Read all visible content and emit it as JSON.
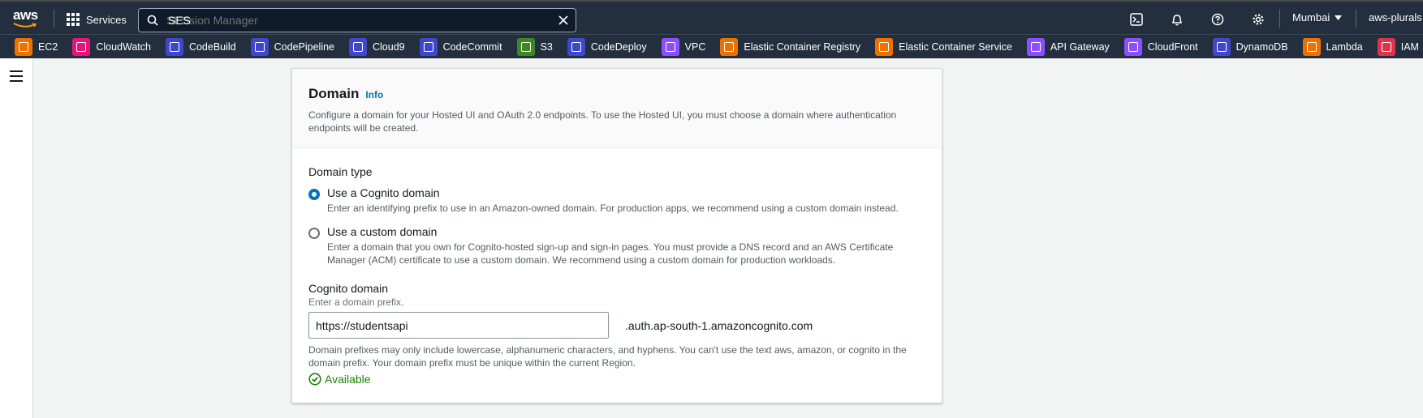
{
  "topnav": {
    "logo_text": "aws",
    "services_label": "Services",
    "search_value": "SES",
    "search_placeholder": "SESsion Manager",
    "region": "Mumbai",
    "account": "aws-plurals",
    "icons": [
      "cloudshell-icon",
      "notifications-bell-icon",
      "help-icon",
      "settings-gear-icon"
    ]
  },
  "favorites": [
    {
      "label": "EC2",
      "color": "#ed7100"
    },
    {
      "label": "CloudWatch",
      "color": "#e7157b"
    },
    {
      "label": "CodeBuild",
      "color": "#3f48cc"
    },
    {
      "label": "CodePipeline",
      "color": "#3f48cc"
    },
    {
      "label": "Cloud9",
      "color": "#3f48cc"
    },
    {
      "label": "CodeCommit",
      "color": "#3f48cc"
    },
    {
      "label": "S3",
      "color": "#3f8624"
    },
    {
      "label": "CodeDeploy",
      "color": "#3f48cc"
    },
    {
      "label": "VPC",
      "color": "#8c4fff"
    },
    {
      "label": "Elastic Container Registry",
      "color": "#ed7100"
    },
    {
      "label": "Elastic Container Service",
      "color": "#ed7100"
    },
    {
      "label": "API Gateway",
      "color": "#8c4fff"
    },
    {
      "label": "CloudFront",
      "color": "#8c4fff"
    },
    {
      "label": "DynamoDB",
      "color": "#3f48cc"
    },
    {
      "label": "Lambda",
      "color": "#ed7100"
    },
    {
      "label": "IAM",
      "color": "#dd344c"
    },
    {
      "label": "",
      "color": "#dd344c"
    }
  ],
  "domain": {
    "title": "Domain",
    "info_link": "Info",
    "description": "Configure a domain for your Hosted UI and OAuth 2.0 endpoints. To use the Hosted UI, you must choose a domain where authentication endpoints will be created.",
    "type_label": "Domain type",
    "options": [
      {
        "label": "Use a Cognito domain",
        "description": "Enter an identifying prefix to use in an Amazon-owned domain. For production apps, we recommend using a custom domain instead.",
        "selected": true
      },
      {
        "label": "Use a custom domain",
        "description": "Enter a domain that you own for Cognito-hosted sign-up and sign-in pages. You must provide a DNS record and an AWS Certificate Manager (ACM) certificate to use a custom domain. We recommend using a custom domain for production workloads.",
        "selected": false
      }
    ],
    "cognito_label": "Cognito domain",
    "cognito_sublabel": "Enter a domain prefix.",
    "prefix_value": "https://studentsapi",
    "suffix": ".auth.ap-south-1.amazoncognito.com",
    "constraint": "Domain prefixes may only include lowercase, alphanumeric characters, and hyphens. You can't use the text aws, amazon, or cognito in the domain prefix. Your domain prefix must be unique within the current Region.",
    "status": "Available",
    "status_color": "#1d8102"
  }
}
